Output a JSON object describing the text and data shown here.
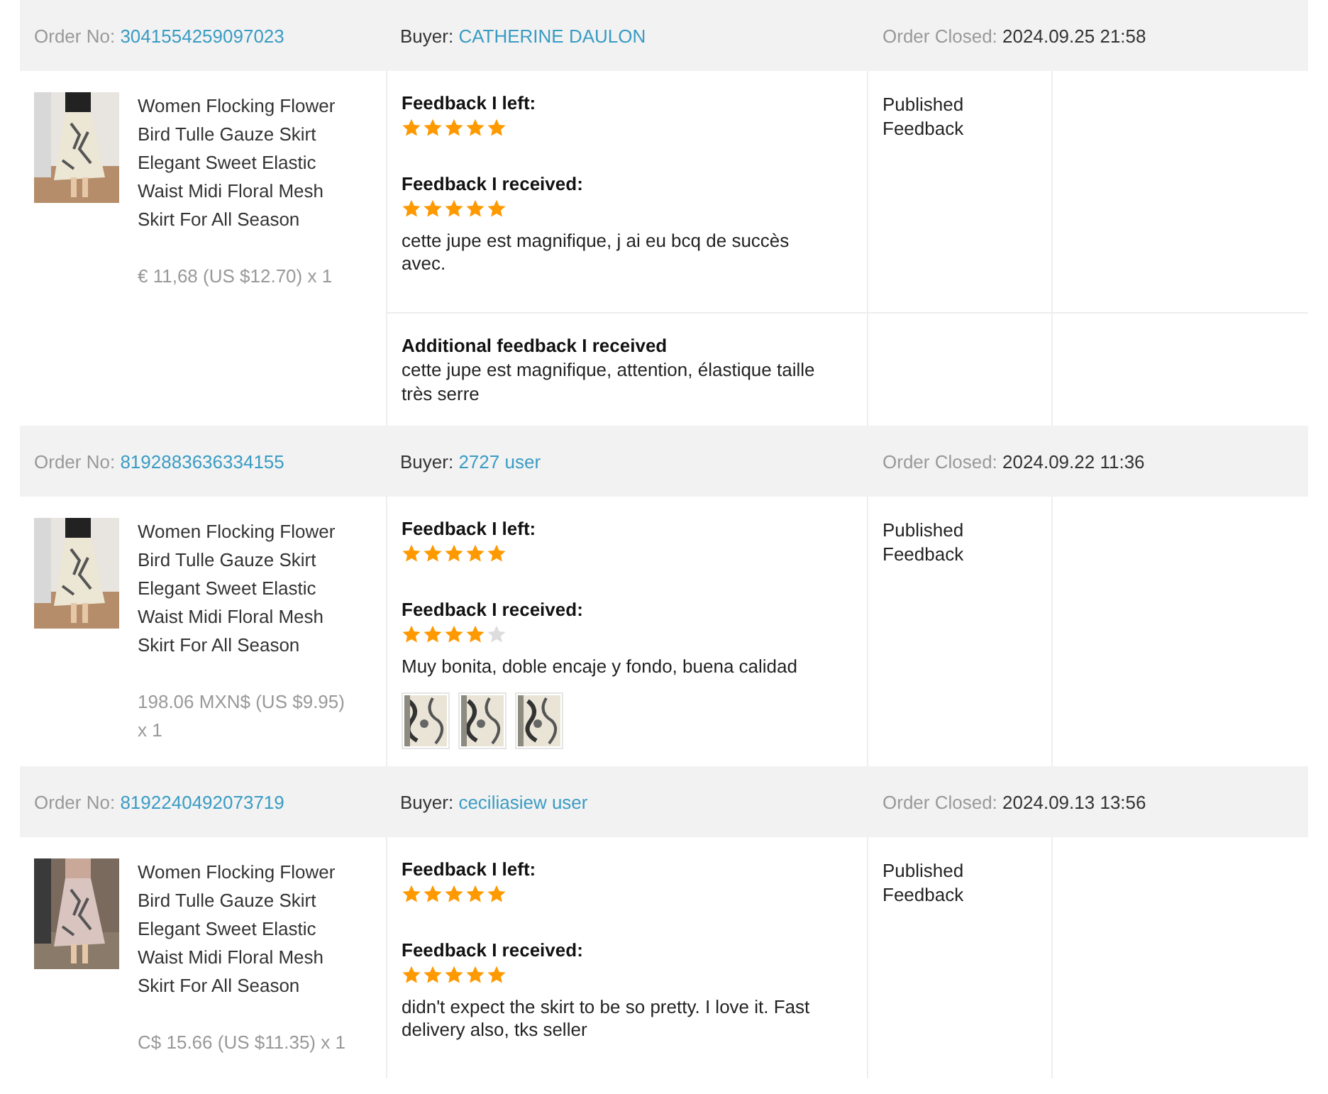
{
  "orders": [
    {
      "order_no_label": "Order No:",
      "order_no": "3041554259097023",
      "buyer_label": "Buyer:",
      "buyer": "CATHERINE DAULON",
      "closed_label": "Order Closed:",
      "closed": "2024.09.25 21:58",
      "product": {
        "image": {
          "kind": "picture"
        },
        "title": "Women Flocking Flower Bird Tulle Gauze Skirt Elegant Sweet Elastic Waist Midi Floral Mesh Skirt For All Season",
        "price": "€ 11,68 (US $12.70) x 1"
      },
      "feedback_left": {
        "label": "Feedback I left:",
        "stars": 5
      },
      "feedback_received": {
        "label": "Feedback I received:",
        "stars": 5,
        "comment": "cette jupe est magnifique, j ai eu bcq de succès avec."
      },
      "additional": {
        "label": "Additional feedback I received",
        "comment": "cette jupe est magnifique, attention, élastique taille très serre"
      },
      "status": "Published Feedback"
    },
    {
      "order_no_label": "Order No:",
      "order_no": "8192883636334155",
      "buyer_label": "Buyer:",
      "buyer": "2727 user",
      "closed_label": "Order Closed:",
      "closed": "2024.09.22 11:36",
      "product": {
        "image": {
          "kind": "picture"
        },
        "title": "Women Flocking Flower Bird Tulle Gauze Skirt Elegant Sweet Elastic Waist Midi Floral Mesh Skirt For All Season",
        "price": "198.06 MXN$ (US $9.95) x 1"
      },
      "feedback_left": {
        "label": "Feedback I left:",
        "stars": 5
      },
      "feedback_received": {
        "label": "Feedback I received:",
        "stars": 4,
        "comment": "Muy bonita, doble encaje y fondo, buena calidad",
        "photos": [
          {
            "kind": "picture"
          },
          {
            "kind": "picture"
          },
          {
            "kind": "picture"
          }
        ]
      },
      "status": "Published Feedback"
    },
    {
      "order_no_label": "Order No:",
      "order_no": "8192240492073719",
      "buyer_label": "Buyer:",
      "buyer": "ceciliasiew user",
      "closed_label": "Order Closed:",
      "closed": "2024.09.13 13:56",
      "product": {
        "image": {
          "kind": "picture"
        },
        "title": "Women Flocking Flower Bird Tulle Gauze Skirt Elegant Sweet Elastic Waist Midi Floral Mesh Skirt For All Season",
        "price": "C$ 15.66 (US $11.35) x 1"
      },
      "feedback_left": {
        "label": "Feedback I left:",
        "stars": 5
      },
      "feedback_received": {
        "label": "Feedback I received:",
        "stars": 5,
        "comment": "didn't expect the skirt to be so pretty. I love it. Fast delivery also, tks seller"
      },
      "status": "Published Feedback"
    }
  ]
}
